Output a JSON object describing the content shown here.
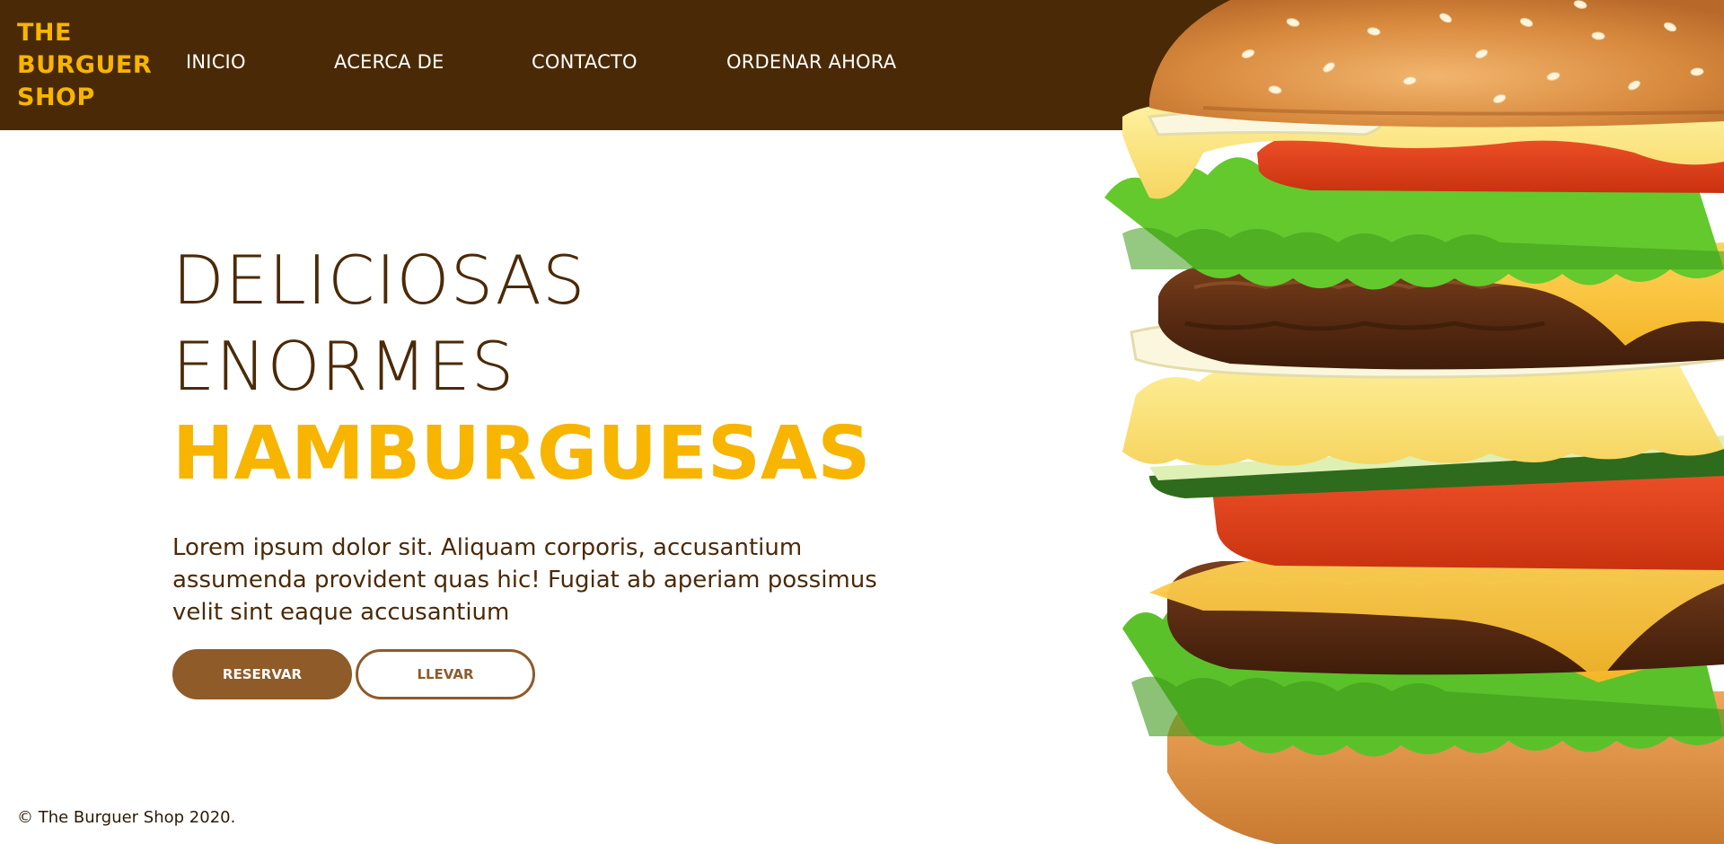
{
  "header": {
    "logo_lines": [
      "THE",
      "BURGUER",
      "SHOP"
    ],
    "nav": [
      "INICIO",
      "ACERCA DE",
      "CONTACTO",
      "ORDENAR AHORA"
    ]
  },
  "hero": {
    "line1": "DELICIOSAS",
    "line2": "ENORMES",
    "line3": "HAMBURGUESAS",
    "description": "Lorem ipsum dolor sit. Aliquam corporis, accusantium assumenda provident quas hic! Fugiat ab aperiam possimus velit sint eaque accusantium",
    "primary_button": "RESERVAR",
    "secondary_button": "LLEVAR"
  },
  "footer": {
    "copyright": "© The Burguer Shop 2020."
  },
  "image": {
    "icon": "burger-photo"
  },
  "colors": {
    "brand_brown": "#4a2a06",
    "accent_yellow": "#f7b500",
    "button_brown": "#8e5b29",
    "text_brown": "#4b2a07"
  }
}
